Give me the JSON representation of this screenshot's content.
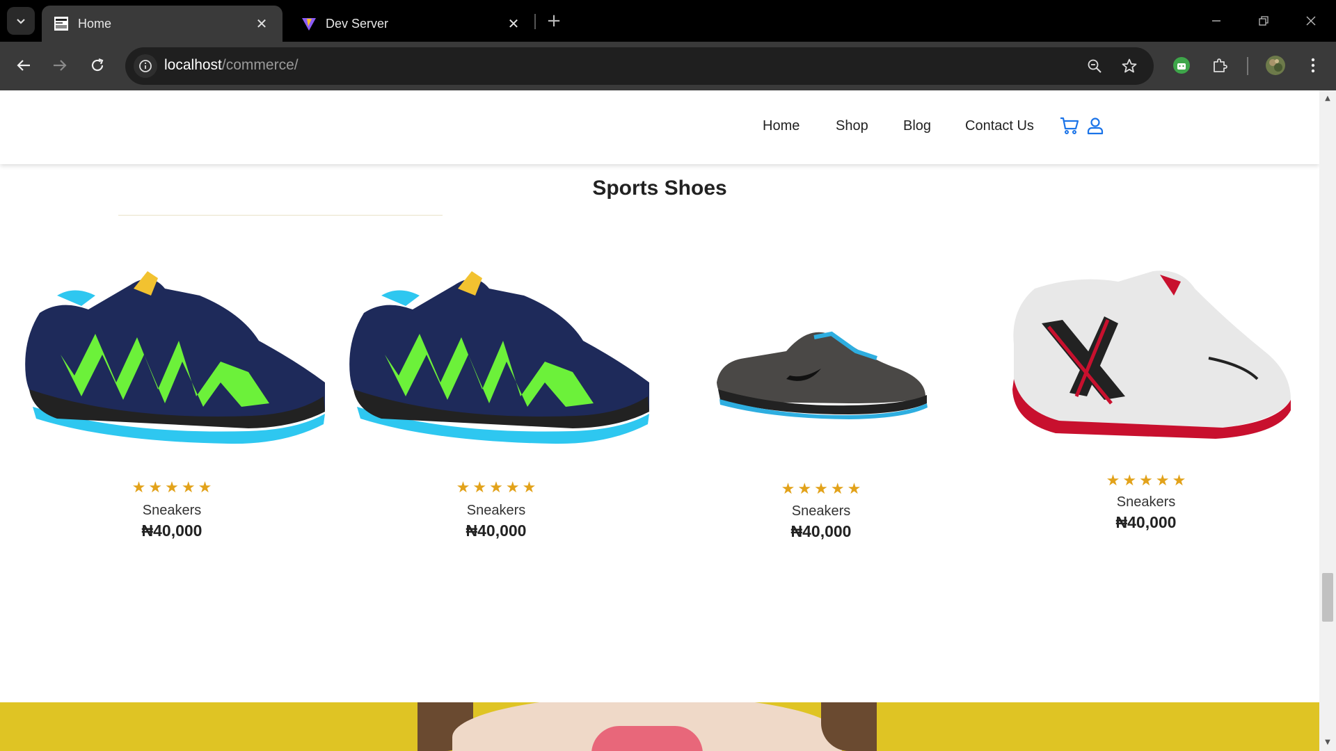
{
  "browser": {
    "tabs": [
      {
        "title": "Home",
        "favicon": "site-favicon",
        "active": true
      },
      {
        "title": "Dev Server",
        "favicon": "vite-icon",
        "active": false
      }
    ],
    "url_host": "localhost",
    "url_path": "/commerce/"
  },
  "site": {
    "nav": [
      "Home",
      "Shop",
      "Blog",
      "Contact Us"
    ],
    "accent_color": "#1a73e8"
  },
  "section": {
    "title": "Sports Shoes"
  },
  "products": [
    {
      "name": "Sneakers",
      "price": "₦40,000",
      "rating": 5,
      "image": "green-blue-trail-shoe"
    },
    {
      "name": "Sneakers",
      "price": "₦40,000",
      "rating": 5,
      "image": "green-blue-trail-shoe"
    },
    {
      "name": "Sneakers",
      "price": "₦40,000",
      "rating": 5,
      "image": "grey-running-shoe"
    },
    {
      "name": "Sneakers",
      "price": "₦40,000",
      "rating": 5,
      "image": "white-red-running-shoe"
    }
  ],
  "colors": {
    "star": "#e2a21a",
    "banner": "#dfc424"
  }
}
